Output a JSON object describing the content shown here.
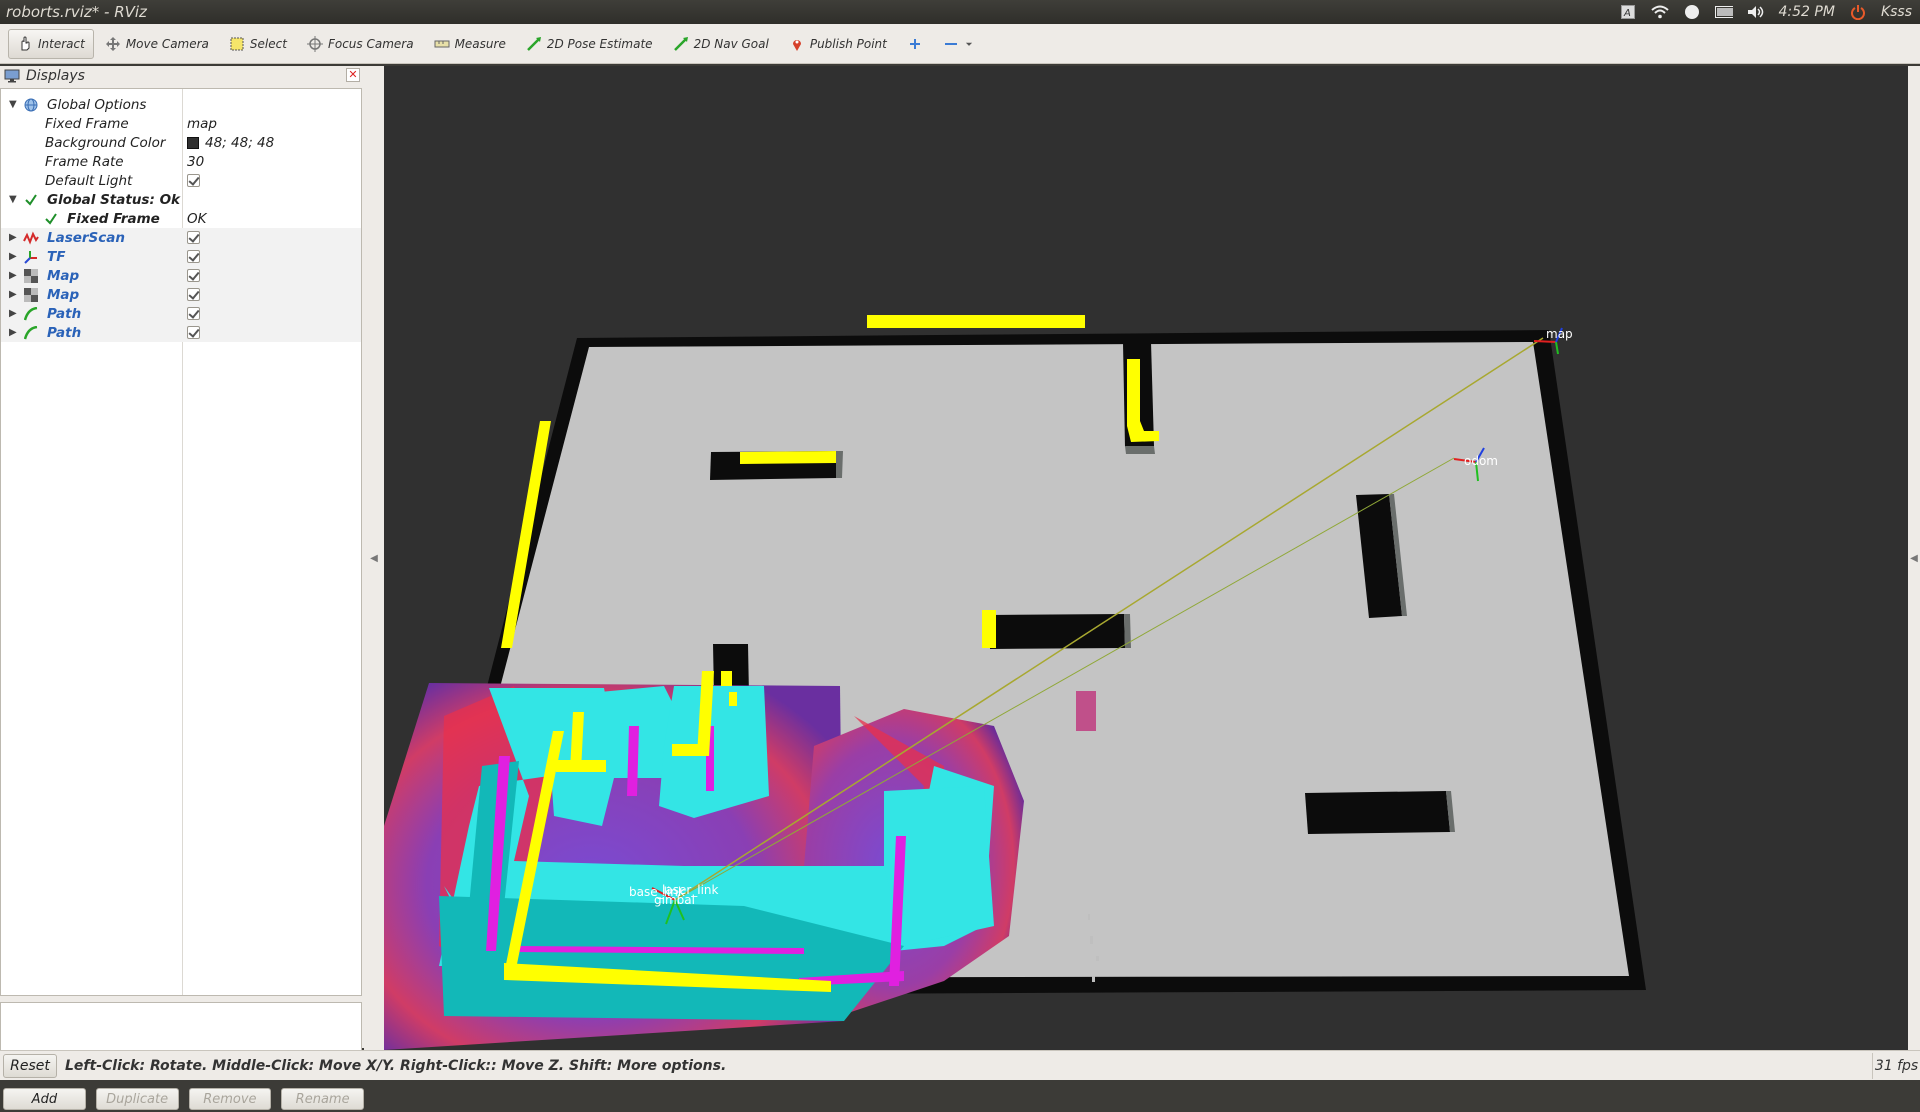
{
  "window": {
    "title": "roborts.rviz* - RViz"
  },
  "tray": {
    "time": "4:52 PM",
    "user": "Ksss"
  },
  "toolbar": {
    "tools": [
      {
        "label": "Interact",
        "icon": "hand-icon",
        "active": true
      },
      {
        "label": "Move Camera",
        "icon": "move-camera-icon"
      },
      {
        "label": "Select",
        "icon": "select-icon"
      },
      {
        "label": "Focus Camera",
        "icon": "focus-camera-icon"
      },
      {
        "label": "Measure",
        "icon": "measure-icon"
      },
      {
        "label": "2D Pose Estimate",
        "icon": "pose-estimate-icon"
      },
      {
        "label": "2D Nav Goal",
        "icon": "nav-goal-icon"
      },
      {
        "label": "Publish Point",
        "icon": "publish-point-icon"
      }
    ]
  },
  "displays": {
    "title": "Displays",
    "global_options": {
      "label": "Global Options",
      "fixed_frame_label": "Fixed Frame",
      "fixed_frame_value": "map",
      "background_color_label": "Background Color",
      "background_color_value": "48; 48; 48",
      "frame_rate_label": "Frame Rate",
      "frame_rate_value": "30",
      "default_light_label": "Default Light"
    },
    "global_status": {
      "label": "Global Status: Ok",
      "fixed_frame_label": "Fixed Frame",
      "fixed_frame_value": "OK"
    },
    "items": [
      {
        "label": "LaserScan",
        "icon": "laserscan-icon"
      },
      {
        "label": "TF",
        "icon": "tf-icon"
      },
      {
        "label": "Map",
        "icon": "map-icon"
      },
      {
        "label": "Map",
        "icon": "map-icon"
      },
      {
        "label": "Path",
        "icon": "path-icon"
      },
      {
        "label": "Path",
        "icon": "path-icon"
      }
    ],
    "buttons": {
      "add": "Add",
      "duplicate": "Duplicate",
      "remove": "Remove",
      "rename": "Rename"
    }
  },
  "viewport": {
    "frame_labels": {
      "map": "map",
      "odom": "odom",
      "base_link": "base_link",
      "laser_link": "laser_link",
      "gimbal": "gimbal"
    },
    "colors": {
      "background": "#303030",
      "map_free": "#c4c4c4",
      "obstacle": "#0c0c0c",
      "laser": "#ffff00",
      "costmap_inscribed": "#33e5e5",
      "costmap_lethal": "#e020e0"
    }
  },
  "status": {
    "reset": "Reset",
    "hint": "Left-Click: Rotate. Middle-Click: Move X/Y. Right-Click:: Move Z. Shift: More options.",
    "fps": "31 fps"
  }
}
